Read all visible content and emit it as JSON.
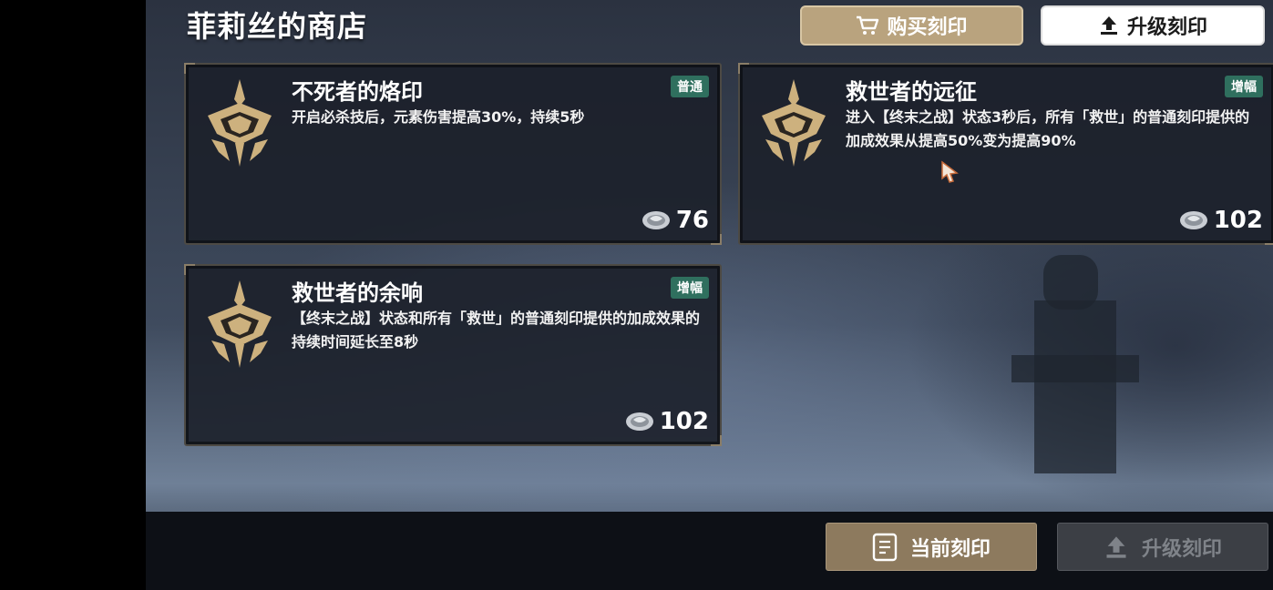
{
  "shop": {
    "title": "菲莉丝的商店"
  },
  "tabs": {
    "buy": {
      "label": "购买刻印",
      "icon": "cart-icon"
    },
    "upgrade": {
      "label": "升级刻印",
      "icon": "upload-icon"
    }
  },
  "cards": [
    {
      "name": "不死者的烙印",
      "tag": "普通",
      "description": "开启必杀技后，元素伤害提高30%，持续5秒",
      "price": "76"
    },
    {
      "name": "救世者的远征",
      "tag": "增幅",
      "description": "进入【终末之战】状态3秒后，所有「救世」的普通刻印提供的加成效果从提高50%变为提高90%",
      "price": "102"
    },
    {
      "name": "救世者的余响",
      "tag": "增幅",
      "description": "【终末之战】状态和所有「救世」的普通刻印提供的加成效果的持续时间延长至8秒",
      "price": "102"
    }
  ],
  "bottom": {
    "current_label": "当前刻印",
    "upgrade_label": "升级刻印"
  },
  "colors": {
    "gold_button": "#8d7a5e",
    "tag_green": "#2f6f5e",
    "emblem_gold": "#cdb17e"
  }
}
